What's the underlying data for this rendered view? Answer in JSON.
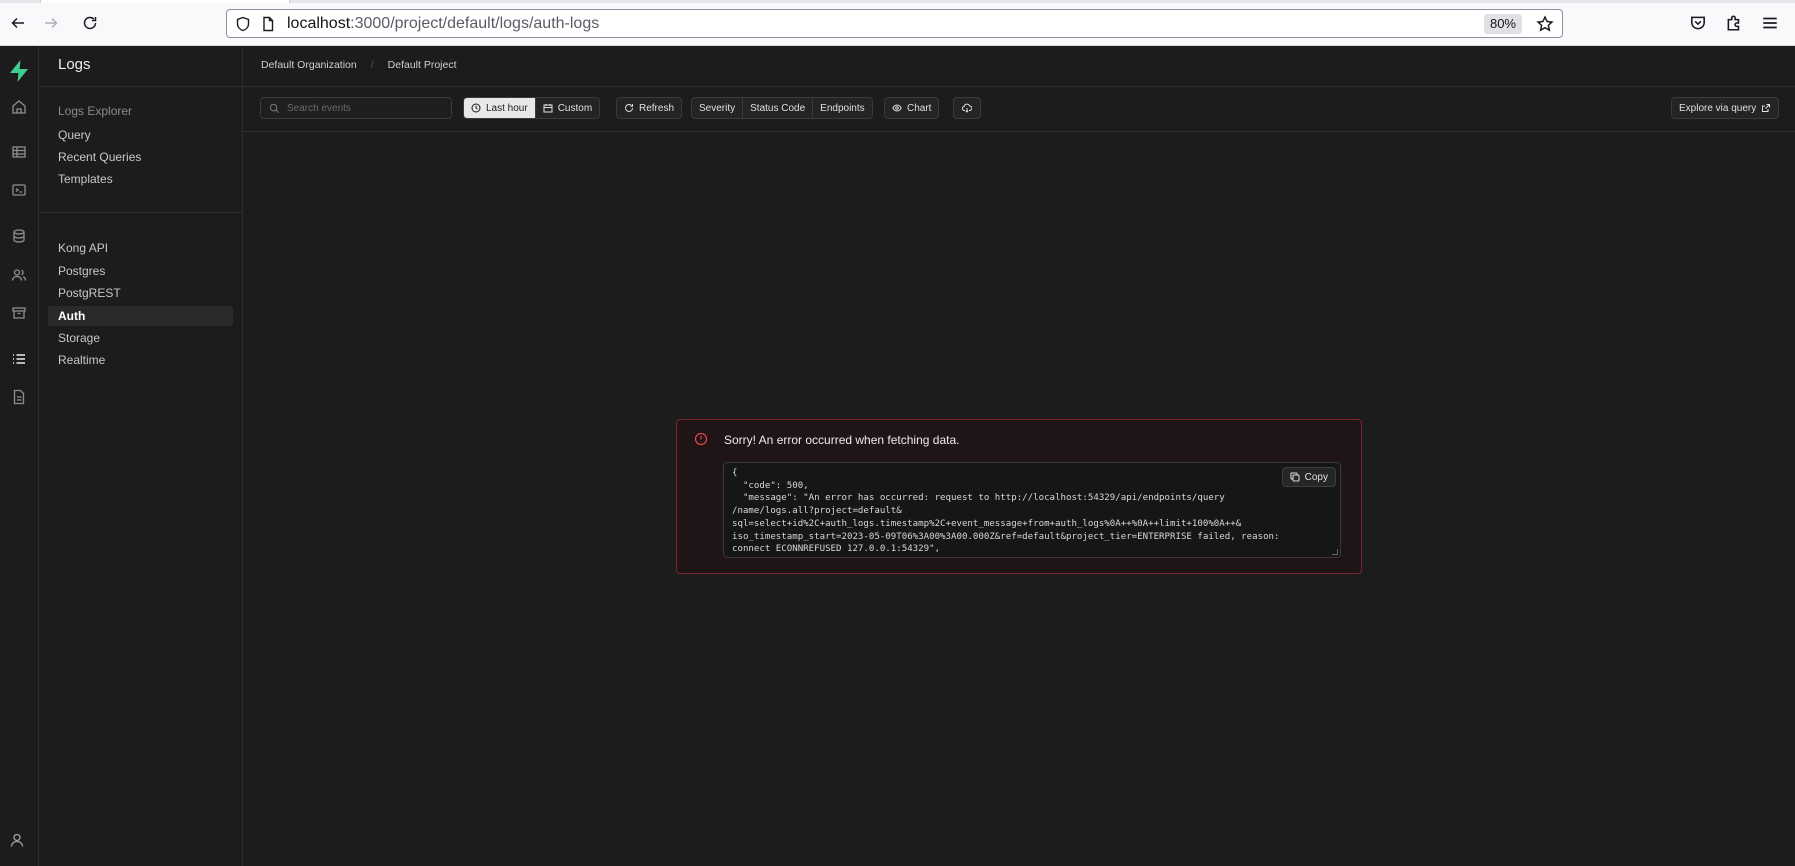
{
  "browser": {
    "url_host": "localhost",
    "url_path": ":3000/project/default/logs/auth-logs",
    "zoom": "80%"
  },
  "app": {
    "section_title": "Logs",
    "breadcrumbs": [
      "Default Organization",
      "Default Project"
    ]
  },
  "sidebar": {
    "explorer_label": "Logs Explorer",
    "explorer_items": [
      {
        "label": "Query"
      },
      {
        "label": "Recent Queries"
      },
      {
        "label": "Templates"
      }
    ],
    "source_items": [
      {
        "label": "Kong API",
        "active": false
      },
      {
        "label": "Postgres",
        "active": false
      },
      {
        "label": "PostgREST",
        "active": false
      },
      {
        "label": "Auth",
        "active": true
      },
      {
        "label": "Storage",
        "active": false
      },
      {
        "label": "Realtime",
        "active": false
      }
    ]
  },
  "toolbar": {
    "search_placeholder": "Search events",
    "last_hour": "Last hour",
    "custom": "Custom",
    "refresh": "Refresh",
    "severity": "Severity",
    "status_code": "Status Code",
    "endpoints": "Endpoints",
    "chart": "Chart",
    "explore": "Explore via query"
  },
  "error": {
    "title": "Sorry! An error occurred when fetching data.",
    "copy_label": "Copy",
    "body": "{\n  \"code\": 500,\n  \"message\": \"An error has occurred: request to http://localhost:54329/api/endpoints/query\n/name/logs.all?project=default&\nsql=select+id%2C+auth_logs.timestamp%2C+event_message+from+auth_logs%0A++%0A++limit+100%0A++&\niso_timestamp_start=2023-05-09T06%3A00%3A00.000Z&ref=default&project_tier=ENTERPRISE failed, reason:\nconnect ECONNREFUSED 127.0.0.1:54329\","
  },
  "colors": {
    "accent": "#3ecf8e",
    "error": "#e5484d",
    "background": "#1c1c1c"
  }
}
